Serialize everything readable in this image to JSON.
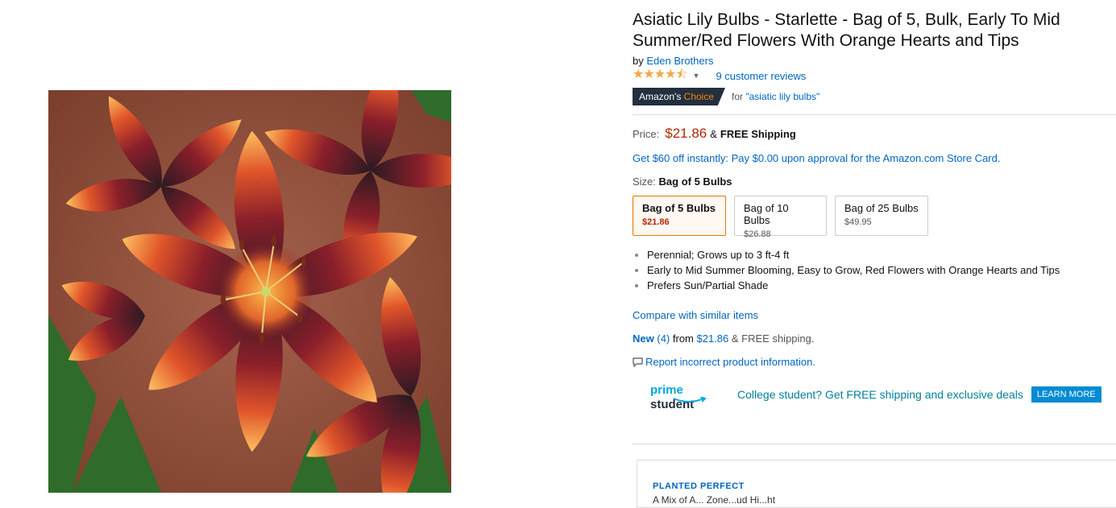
{
  "product": {
    "title": "Asiatic Lily Bulbs - Starlette - Bag of 5, Bulk, Early To Mid Summer/Red Flowers With Orange Hearts and Tips",
    "by_prefix": "by",
    "brand": "Eden Brothers",
    "rating_value": 4.5,
    "stars": "★★★★⯪",
    "reviews_link": "9 customer reviews",
    "badge": {
      "amazons": "Amazon's",
      "choice": "Choice"
    },
    "choice_for_prefix": "for",
    "choice_query": "\"asiatic lily bulbs\""
  },
  "price": {
    "label": "Price:",
    "value": "$21.86",
    "amp": "&",
    "shipping": "FREE Shipping"
  },
  "promo": "Get $60 off instantly: Pay $0.00 upon approval for the Amazon.com Store Card.",
  "size": {
    "label": "Size:",
    "selected": "Bag of 5 Bulbs",
    "options": [
      {
        "name": "Bag of 5 Bulbs",
        "price": "$21.86",
        "selected": true
      },
      {
        "name": "Bag of 10 Bulbs",
        "price": "$26.88",
        "selected": false
      },
      {
        "name": "Bag of 25 Bulbs",
        "price": "$49.95",
        "selected": false
      }
    ]
  },
  "features": [
    "Perennial; Grows up to 3 ft-4 ft",
    "Early to Mid Summer Blooming, Easy to Grow, Red Flowers with Orange Hearts and Tips",
    "Prefers Sun/Partial Shade"
  ],
  "compare_link": "Compare with similar items",
  "offers": {
    "new_label": "New",
    "count": "(4)",
    "from_prefix": "from",
    "from_price": "$21.86",
    "suffix": "& FREE shipping."
  },
  "report_link": "Report incorrect product information.",
  "prime_student": {
    "logo_prime": "prime",
    "logo_student": "student",
    "message": "College student? Get FREE shipping and exclusive deals",
    "button": "LEARN MORE"
  },
  "card": {
    "heading": "PLANTED PERFECT",
    "cut_text": "A Mix of A... Zone...ud Hi...ht"
  },
  "colors": {
    "link": "#0066c0",
    "price": "#b12704",
    "star": "#f3a847",
    "badge_bg": "#232f3e",
    "choice_orange": "#f08804",
    "prime_blue": "#00a8e1",
    "prime_teal": "#008296",
    "learn_more_bg": "#008bd4",
    "selected_border": "#e77600"
  },
  "icons": {
    "report": "speech-bubble-icon",
    "prime_smile": "smile-arrow-icon",
    "rating_caret": "caret-down-icon"
  }
}
